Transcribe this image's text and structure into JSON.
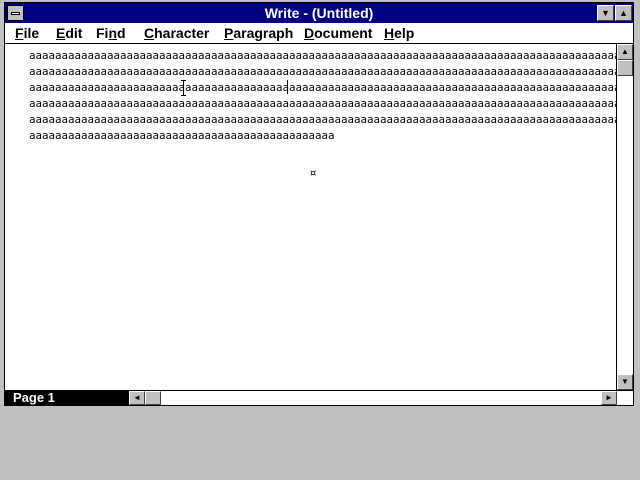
{
  "window": {
    "title": "Write - (Untitled)"
  },
  "menu": {
    "items": [
      {
        "pre": "",
        "key": "F",
        "post": "ile"
      },
      {
        "pre": "",
        "key": "E",
        "post": "dit"
      },
      {
        "pre": "Fi",
        "key": "n",
        "post": "d"
      },
      {
        "pre": "",
        "key": "C",
        "post": "haracter"
      },
      {
        "pre": "",
        "key": "P",
        "post": "aragraph"
      },
      {
        "pre": "",
        "key": "D",
        "post": "ocument"
      },
      {
        "pre": "",
        "key": "H",
        "post": "elp"
      }
    ]
  },
  "document": {
    "lines": [
      "aaaaaaaaaaaaaaaaaaaaaaaaaaaaaaaaaaaaaaaaaaaaaaaaaaaaaaaaaaaaaaaaaaaaaaaaaaaaaaaaaaaaaaaaaaaaaaaa",
      "aaaaaaaaaaaaaaaaaaaaaaaaaaaaaaaaaaaaaaaaaaaaaaaaaaaaaaaaaaaaaaaaaaaaaaaaaaaaaaaaaaaaaaaaaaaaaaaa",
      "aaaaaaaaaaaaaaaaaaaaaaaaaaaaaaaaaaaaaaaaaaaaaaaaaaaaaaaaaaaaaaaaaaaaaaaaaaaaaaaaaaaaaaaaaaaaaaaa",
      "aaaaaaaaaaaaaaaaaaaaaaaaaaaaaaaaaaaaaaaaaaaaaaaaaaaaaaaaaaaaaaaaaaaaaaaaaaaaaaaaaaaaaaaaaaaaaaaa",
      "aaaaaaaaaaaaaaaaaaaaaaaaaaaaaaaaaaaaaaaaaaaaaaaaaaaaaaaaaaaaaaaaaaaaaaaaaaaaaaaaaaaaaaaaaaaaaaaa",
      "aaaaaaaaaaaaaaaaaaaaaaaaaaaaaaaaaaaaaaaaaaaaaaa"
    ],
    "end_mark": "¤"
  },
  "status": {
    "page_label": "Page 1"
  },
  "icons": {
    "minimize": "▼",
    "maximize": "▲",
    "scroll_up": "▲",
    "scroll_down": "▼",
    "scroll_left": "◄",
    "scroll_right": "►"
  }
}
